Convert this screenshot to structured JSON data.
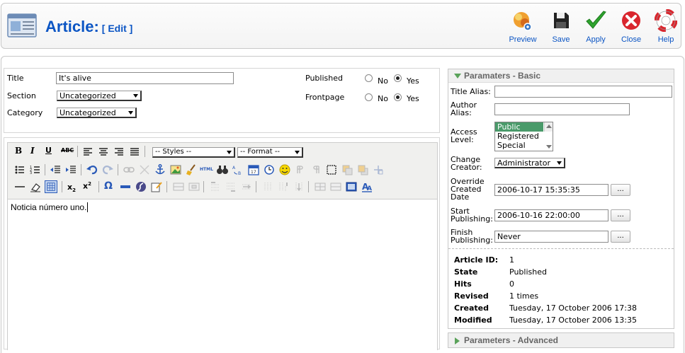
{
  "header": {
    "title": "Article:",
    "subtitle": "[ Edit ]"
  },
  "toolbar": [
    {
      "label": "Preview",
      "icon": "preview-icon"
    },
    {
      "label": "Save",
      "icon": "save-icon"
    },
    {
      "label": "Apply",
      "icon": "apply-icon"
    },
    {
      "label": "Close",
      "icon": "close-icon"
    },
    {
      "label": "Help",
      "icon": "help-icon"
    }
  ],
  "details": {
    "title_label": "Title",
    "title_value": "It's alive",
    "section_label": "Section",
    "section_value": "Uncategorized",
    "category_label": "Category",
    "category_value": "Uncategorized",
    "published_label": "Published",
    "frontpage_label": "Frontpage",
    "no": "No",
    "yes": "Yes",
    "published": "Yes",
    "frontpage": "Yes"
  },
  "editor": {
    "styles_value": "-- Styles --",
    "format_value": "-- Format --",
    "html_label": "HTML",
    "content": "Noticia número uno."
  },
  "params_basic": {
    "heading": "Paramaters - Basic",
    "title_alias_label": "Title Alias:",
    "title_alias_value": "",
    "author_alias_label": "Author Alias:",
    "author_alias_value": "",
    "access_label": "Access Level:",
    "access_options": [
      "Public",
      "Registered",
      "Special"
    ],
    "access_selected": "Public",
    "creator_label": "Change Creator:",
    "creator_value": "Administrator",
    "override_label": "Override Created Date",
    "override_value": "2006-10-17 15:35:35",
    "start_label": "Start Publishing:",
    "start_value": "2006-10-16 22:00:00",
    "finish_label": "Finish Publishing:",
    "finish_value": "Never",
    "picker_label": "..."
  },
  "info": [
    {
      "key": "Article ID:",
      "value": "1"
    },
    {
      "key": "State",
      "value": "Published"
    },
    {
      "key": "Hits",
      "value": "0"
    },
    {
      "key": "Revised",
      "value": "1 times"
    },
    {
      "key": "Created",
      "value": "Tuesday, 17 October 2006 17:38"
    },
    {
      "key": "Modified",
      "value": "Tuesday, 17 October 2006 13:35"
    }
  ],
  "params_advanced": {
    "heading": "Parameters - Advanced"
  },
  "colors": {
    "link_blue": "#0b55c4",
    "apply_green": "#2ea32e",
    "close_red": "#d9262e"
  }
}
